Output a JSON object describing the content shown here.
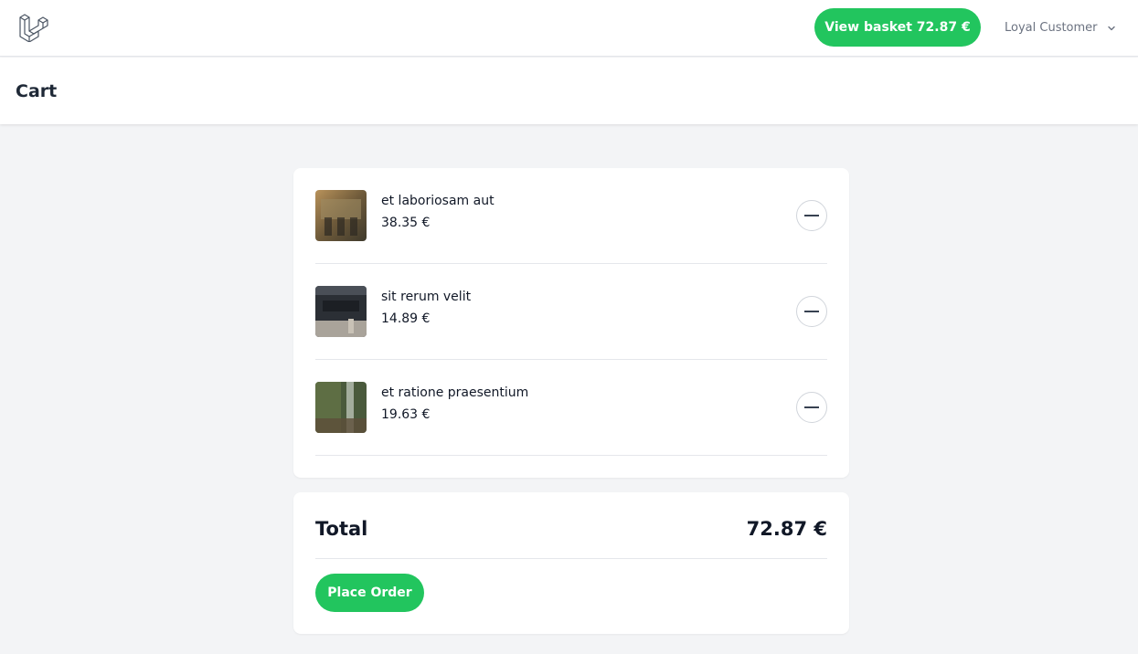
{
  "nav": {
    "logo": "laravel-logo",
    "basket_button": "View basket 72.87 €",
    "user_name": "Loyal Customer"
  },
  "header": {
    "title": "Cart"
  },
  "cart": {
    "items": [
      {
        "name": "et laboriosam aut",
        "price": "38.35 €"
      },
      {
        "name": "sit rerum velit",
        "price": "14.89 €"
      },
      {
        "name": "et ratione praesentium",
        "price": "19.63 €"
      }
    ]
  },
  "summary": {
    "total_label": "Total",
    "total_value": "72.87 €",
    "place_order": "Place Order"
  },
  "colors": {
    "accent": "#22c55e",
    "background": "#f3f4f6",
    "card": "#ffffff",
    "text": "#111827"
  }
}
